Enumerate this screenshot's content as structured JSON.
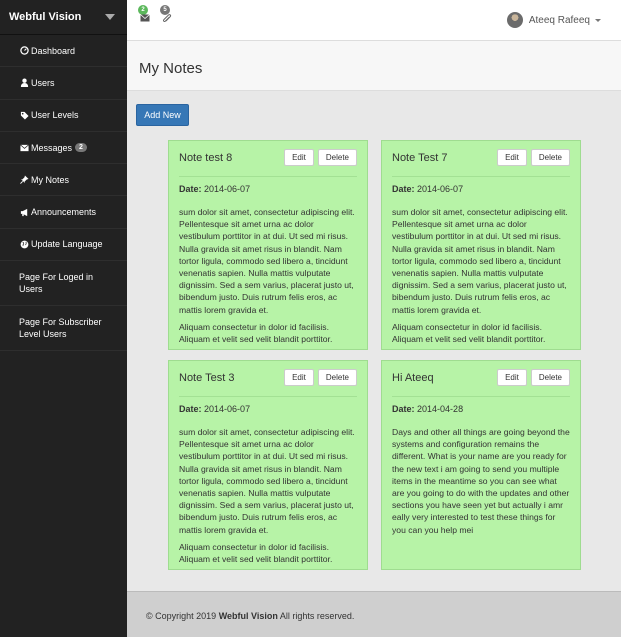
{
  "brand": {
    "title": "Webful Vision"
  },
  "sidebar": {
    "items": [
      {
        "label": "Dashboard",
        "icon": "dashboard-icon"
      },
      {
        "label": "Users",
        "icon": "user-icon"
      },
      {
        "label": "User Levels",
        "icon": "tag-icon"
      },
      {
        "label": "Messages",
        "icon": "envelope-icon",
        "badge": "2"
      },
      {
        "label": "My Notes",
        "icon": "pushpin-icon"
      },
      {
        "label": "Announcements",
        "icon": "bullhorn-icon"
      },
      {
        "label": "Update Language",
        "icon": "globe-icon"
      },
      {
        "label": "Page For Loged in Users"
      },
      {
        "label": "Page For Subscriber Level Users"
      }
    ]
  },
  "topbar": {
    "messages_count": "2",
    "messages_color": "#5cb85c",
    "notes_count": "5",
    "notes_color": "#777777",
    "user_name": "Ateeq Rafeeq"
  },
  "page": {
    "title": "My Notes",
    "add_label": "Add New"
  },
  "notes": [
    {
      "title": "Note test 8",
      "date_label": "Date:",
      "date": "2014-06-07",
      "p1": "sum dolor sit amet, consectetur adipiscing elit. Pellentesque sit amet urna ac dolor vestibulum porttitor in at dui. Ut sed mi risus. Nulla gravida sit amet risus in blandit. Nam tortor ligula, commodo sed libero a, tincidunt venenatis sapien. Nulla mattis vulputate dignissim. Sed a sem varius, placerat justo ut, bibendum justo. Duis rutrum felis eros, ac mattis lorem gravida et.",
      "p2": "Aliquam consectetur in dolor id facilisis. Aliquam et velit sed velit blandit porttitor.",
      "edit_label": "Edit",
      "delete_label": "Delete"
    },
    {
      "title": "Note Test 7",
      "date_label": "Date:",
      "date": "2014-06-07",
      "p1": "sum dolor sit amet, consectetur adipiscing elit. Pellentesque sit amet urna ac dolor vestibulum porttitor in at dui. Ut sed mi risus. Nulla gravida sit amet risus in blandit. Nam tortor ligula, commodo sed libero a, tincidunt venenatis sapien. Nulla mattis vulputate dignissim. Sed a sem varius, placerat justo ut, bibendum justo. Duis rutrum felis eros, ac mattis lorem gravida et.",
      "p2": "Aliquam consectetur in dolor id facilisis. Aliquam et velit sed velit blandit porttitor.",
      "edit_label": "Edit",
      "delete_label": "Delete"
    },
    {
      "title": "Note Test 3",
      "date_label": "Date:",
      "date": "2014-06-07",
      "p1": "sum dolor sit amet, consectetur adipiscing elit. Pellentesque sit amet urna ac dolor vestibulum porttitor in at dui. Ut sed mi risus. Nulla gravida sit amet risus in blandit. Nam tortor ligula, commodo sed libero a, tincidunt venenatis sapien. Nulla mattis vulputate dignissim. Sed a sem varius, placerat justo ut, bibendum justo. Duis rutrum felis eros, ac mattis lorem gravida et.",
      "p2": "Aliquam consectetur in dolor id facilisis. Aliquam et velit sed velit blandit porttitor.",
      "edit_label": "Edit",
      "delete_label": "Delete"
    },
    {
      "title": "Hi Ateeq",
      "date_label": "Date:",
      "date": "2014-04-28",
      "p1": "Days and other all things are going beyond the systems and configuration remains the different. What is your name are you ready for the new text i am going to send you multiple items in the meantime so you can see what are you going to do with the updates and other sections you have seen yet but actually i amr eally very interested to test these things for you can you help mei",
      "p2": "",
      "edit_label": "Edit",
      "delete_label": "Delete"
    }
  ],
  "footer": {
    "prefix": "© Copyright 2019",
    "company": "Webful Vision",
    "suffix": "All rights reserved."
  },
  "colors": {
    "sidebar_bg": "#222222",
    "note_bg": "#b7f3a7",
    "primary_button": "#3677b6",
    "footer_bg": "#cfcfcf"
  }
}
